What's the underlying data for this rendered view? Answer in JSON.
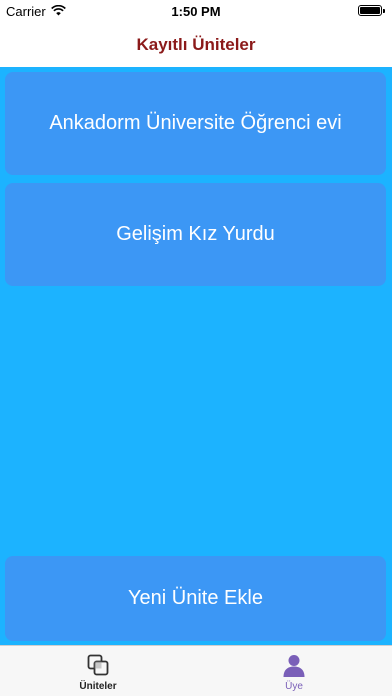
{
  "status_bar": {
    "carrier": "Carrier",
    "time": "1:50 PM",
    "wifi_icon": "wifi-icon",
    "battery_icon": "battery-icon"
  },
  "nav": {
    "title": "Kayıtlı Üniteler"
  },
  "units": [
    {
      "name": "Ankadorm Üniversite Öğrenci evi"
    },
    {
      "name": "Gelişim Kız Yurdu"
    }
  ],
  "add_button": {
    "label": "Yeni Ünite Ekle"
  },
  "tabs": [
    {
      "label": "Üniteler",
      "icon": "units-icon",
      "selected": true
    },
    {
      "label": "Üye",
      "icon": "member-icon",
      "selected": false
    }
  ],
  "colors": {
    "nav_title": "#8b1a1a",
    "content_bg": "#1cb3ff",
    "card_bg": "#3c97f5",
    "tab_active": "#222222",
    "tab_member": "#7a5fb8"
  }
}
